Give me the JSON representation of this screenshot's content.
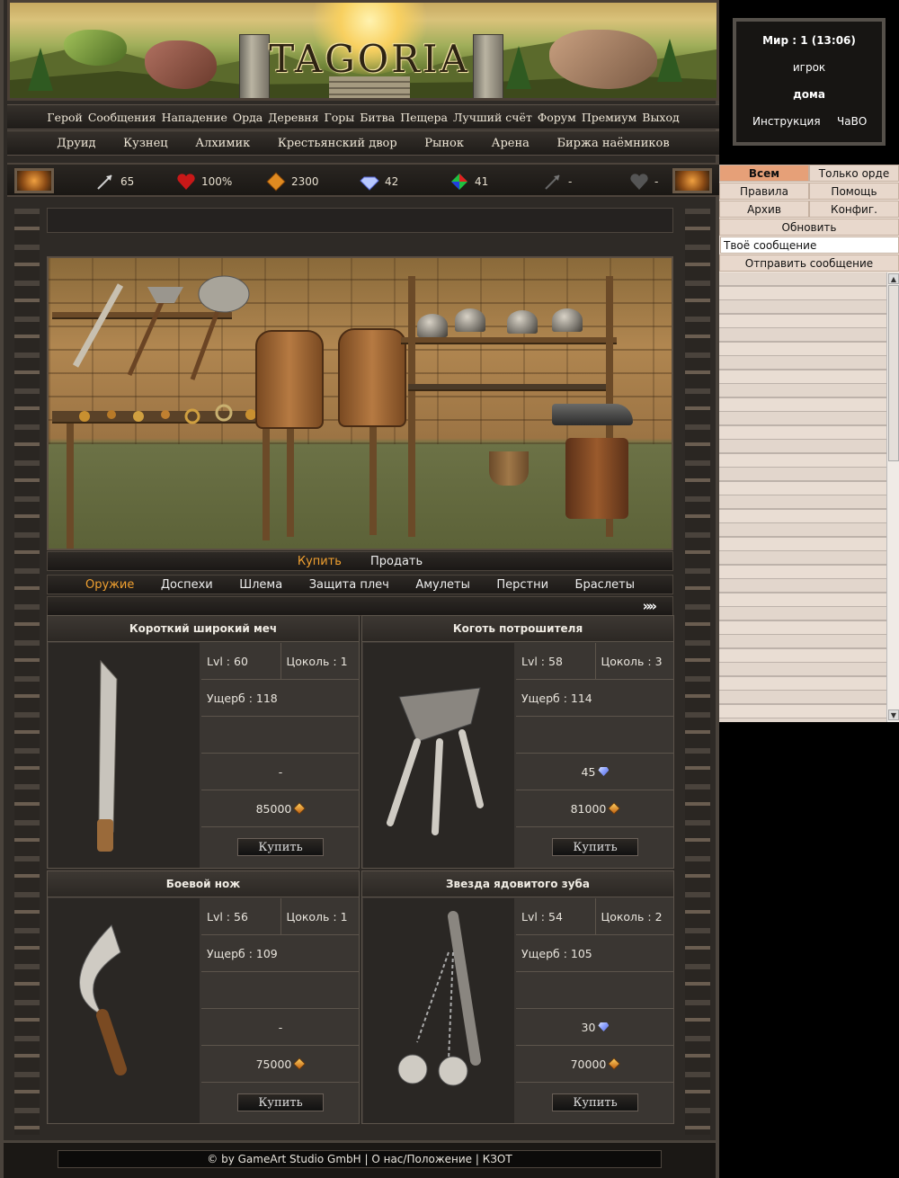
{
  "banner": {
    "logo": "TAGORIA"
  },
  "nav_main": [
    "Герой",
    "Сообщения",
    "Нападение",
    "Орда",
    "Деревня",
    "Горы",
    "Битва",
    "Пещера",
    "Лучший счёт",
    "Форум",
    "Премиум",
    "Выход"
  ],
  "nav_buildings": [
    "Друид",
    "Кузнец",
    "Алхимик",
    "Крестьянский двор",
    "Рынок",
    "Арена",
    "Биржа наёмников"
  ],
  "resources": {
    "attack": "65",
    "health": "100%",
    "gold": "2300",
    "gems": "42",
    "crystals": "41",
    "weapon_slot": "-",
    "armor_slot": "-"
  },
  "trade_tabs": [
    "Купить",
    "Продать"
  ],
  "trade_active": 0,
  "categories": [
    "Оружие",
    "Доспехи",
    "Шлема",
    "Защита плеч",
    "Амулеты",
    "Перстни",
    "Браслеты"
  ],
  "category_active": 0,
  "pager_next": "»»",
  "items": [
    {
      "name": "Короткий широкий меч",
      "lvl": "Lvl : 60",
      "socket": "Цоколь : 1",
      "damage": "Ущерб : 118",
      "gem_cost": "-",
      "gold_cost": "85000",
      "buy": "Купить"
    },
    {
      "name": "Коготь потрошителя",
      "lvl": "Lvl : 58",
      "socket": "Цоколь : 3",
      "damage": "Ущерб : 114",
      "gem_cost": "45",
      "gold_cost": "81000",
      "buy": "Купить"
    },
    {
      "name": "Боевой нож",
      "lvl": "Lvl : 56",
      "socket": "Цоколь : 1",
      "damage": "Ущерб : 109",
      "gem_cost": "-",
      "gold_cost": "75000",
      "buy": "Купить"
    },
    {
      "name": "Звезда ядовитого зуба",
      "lvl": "Lvl : 54",
      "socket": "Цоколь : 2",
      "damage": "Ущерб : 105",
      "gem_cost": "30",
      "gold_cost": "70000",
      "buy": "Купить"
    }
  ],
  "footer": "© by GameArt Studio GmbH | О нас/Положение | КЗОТ",
  "world": {
    "title": "Мир : 1 (13:06)",
    "player": "игрок",
    "location": "дома",
    "help": "Инструкция",
    "faq": "ЧаВО"
  },
  "chat": {
    "tab_all": "Всем",
    "tab_horde": "Только орде",
    "rules": "Правила",
    "help": "Помощь",
    "archive": "Архив",
    "config": "Конфиг.",
    "refresh": "Обновить",
    "input_value": "Твоё сообщение",
    "send": "Отправить сообщение"
  },
  "colors": {
    "active_tab": "#f0a030",
    "chat_tab_on": "#e6a078"
  }
}
